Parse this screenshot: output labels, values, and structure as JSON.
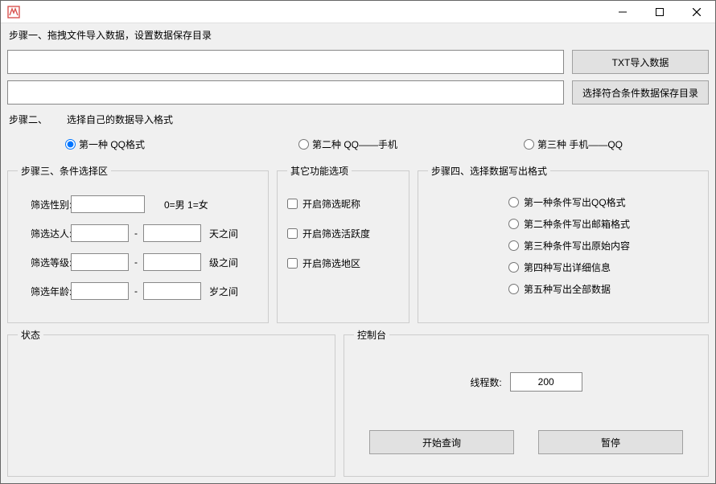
{
  "titlebar": {
    "title": ""
  },
  "step1": {
    "label": "步骤一、拖拽文件导入数据，设置数据保存目录",
    "input_drop": "",
    "input_savepath": "",
    "btn_import_txt": "TXT导入数据",
    "btn_choose_savepath": "选择符合条件数据保存目录"
  },
  "step2": {
    "prefix": "步骤二、",
    "label": "选择自己的数据导入格式",
    "opt1": "第一种 QQ格式",
    "opt2": "第二种 QQ——手机",
    "opt3": "第三种 手机——QQ",
    "selected": "opt1"
  },
  "step3": {
    "legend": "步骤三、条件选择区",
    "gender_label": "筛选性别:",
    "gender_value": "",
    "gender_key": "0=男   1=女",
    "daren_label": "筛选达人:",
    "daren_from": "",
    "daren_to": "",
    "daren_suffix": "天之间",
    "level_label": "筛选等级:",
    "level_from": "",
    "level_to": "",
    "level_suffix": "级之间",
    "age_label": "筛选年龄:",
    "age_from": "",
    "age_to": "",
    "age_suffix": "岁之间"
  },
  "other": {
    "legend": "其它功能选项",
    "nickname": "开启筛选昵称",
    "activity": "开启筛选活跃度",
    "region": "开启筛选地区"
  },
  "step4": {
    "legend": "步骤四、选择数据写出格式",
    "opt1": "第一种条件写出QQ格式",
    "opt2": "第二种条件写出邮箱格式",
    "opt3": "第三种条件写出原始内容",
    "opt4": "第四种写出详细信息",
    "opt5": "第五种写出全部数据"
  },
  "status": {
    "legend": "状态"
  },
  "console": {
    "legend": "控制台",
    "threads_label": "线程数:",
    "threads_value": "200",
    "btn_start": "开始查询",
    "btn_pause": "暂停"
  }
}
